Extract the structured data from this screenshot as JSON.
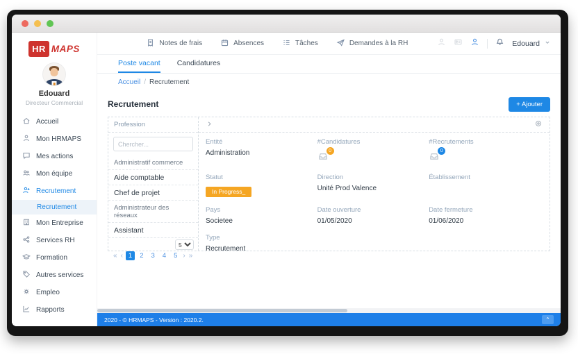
{
  "colors": {
    "accent": "#1e88e5",
    "footer_blue": "#1e7fe8",
    "badge_orange": "#f5a623",
    "badge_blue": "#1e88e5",
    "logo_red": "#ce332e",
    "status_orange": "#f5a623"
  },
  "topnav": {
    "items": [
      {
        "label": "Notes de frais",
        "icon": "receipt-icon"
      },
      {
        "label": "Absences",
        "icon": "calendar-icon"
      },
      {
        "label": "Tâches",
        "icon": "tasks-icon"
      },
      {
        "label": "Demandes à la RH",
        "icon": "paper-plane-icon"
      }
    ],
    "user_label": "Edouard"
  },
  "sidebar": {
    "logo": {
      "hr": "HR",
      "maps": "MAPS"
    },
    "user": {
      "name": "Edouard",
      "role": "Directeur Commercial"
    },
    "items": [
      {
        "label": "Accueil"
      },
      {
        "label": "Mon HRMAPS"
      },
      {
        "label": "Mes actions"
      },
      {
        "label": "Mon équipe"
      },
      {
        "label": "Recrutement"
      },
      {
        "label": "Recrutement"
      },
      {
        "label": "Mon Entreprise"
      },
      {
        "label": "Services RH"
      },
      {
        "label": "Formation"
      },
      {
        "label": "Autres services"
      },
      {
        "label": "Empleo"
      },
      {
        "label": "Rapports"
      }
    ]
  },
  "tabs": [
    {
      "label": "Poste vacant"
    },
    {
      "label": "Candidatures"
    }
  ],
  "breadcrumb": {
    "home": "Accueil",
    "separator": "/",
    "current": "Recrutement"
  },
  "page": {
    "title": "Recrutement",
    "add_button": "+ Ajouter"
  },
  "filter": {
    "column_header": "Profession",
    "search_placeholder": "Chercher..."
  },
  "professions": [
    {
      "label": "Administratif commerce"
    },
    {
      "label": "Aide comptable"
    },
    {
      "label": "Chef de projet"
    },
    {
      "label": "Administrateur des réseaux"
    },
    {
      "label": "Assistant"
    }
  ],
  "pagination": {
    "first": "«",
    "prev": "‹",
    "pages": [
      "1",
      "2",
      "3",
      "4",
      "5"
    ],
    "current": "1",
    "next": "›",
    "last": "»",
    "page_size": "5"
  },
  "details": {
    "fields": [
      {
        "label": "Entité",
        "value": "Administration"
      },
      {
        "label": "#Candidatures",
        "badge": "0",
        "badge_color": "#f5a623"
      },
      {
        "label": "#Recrutements",
        "badge": "0",
        "badge_color": "#1e88e5"
      },
      {
        "label": "Statut",
        "status": "In Progress_"
      },
      {
        "label": "Direction",
        "value": "Unité Prod Valence"
      },
      {
        "label": "Établissement",
        "value": ""
      },
      {
        "label": "Pays",
        "value": "Societee"
      },
      {
        "label": "Date ouverture",
        "value": "01/05/2020"
      },
      {
        "label": "Date fermeture",
        "value": "01/06/2020"
      },
      {
        "label": "Type",
        "value": "Recrutement"
      }
    ]
  },
  "footer": {
    "text": "2020 - © HRMAPS - Version : 2020.2.",
    "to_top": "⌃"
  }
}
